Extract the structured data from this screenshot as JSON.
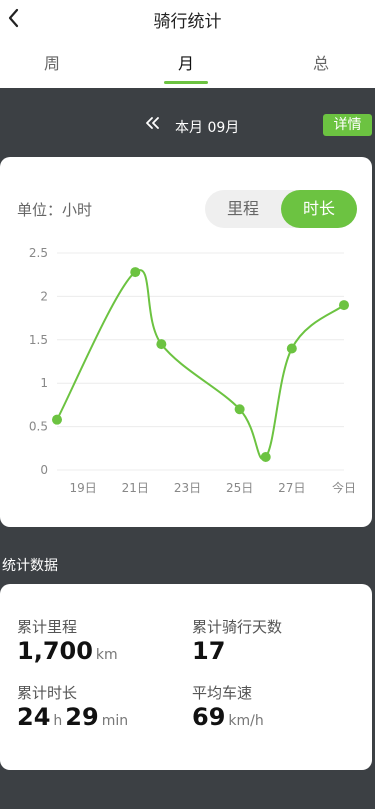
{
  "header": {
    "title": "骑行统计",
    "back_icon": "chevron-left-icon"
  },
  "tabs": [
    {
      "label": "周",
      "active": false
    },
    {
      "label": "月",
      "active": true
    },
    {
      "label": "总",
      "active": false
    }
  ],
  "month_bar": {
    "prev_icon": "double-chevron-left-icon",
    "label": "本月 09月",
    "detail_label": "详情"
  },
  "chart_section": {
    "unit_label": "单位：小时",
    "toggle": {
      "options": [
        "里程",
        "时长"
      ],
      "selected": "时长"
    }
  },
  "chart_data": {
    "type": "line",
    "categories": [
      "19日",
      "21日",
      "23日",
      "25日",
      "27日",
      "今日"
    ],
    "points": [
      {
        "x": 18,
        "y": 0.58
      },
      {
        "x": 21,
        "y": 2.28
      },
      {
        "x": 22,
        "y": 1.45
      },
      {
        "x": 25,
        "y": 0.7
      },
      {
        "x": 26,
        "y": 0.15
      },
      {
        "x": 27,
        "y": 1.4
      },
      {
        "x": 29,
        "y": 1.9
      }
    ],
    "yticks": [
      "0",
      "0.5",
      "1",
      "1.5",
      "2",
      "2.5"
    ],
    "ylim": [
      0,
      2.5
    ],
    "xlim": [
      18,
      29
    ],
    "grid": true,
    "color": "#6cc341"
  },
  "stats": {
    "section_title": "统计数据",
    "total_distance": {
      "label": "累计里程",
      "value": "1,700",
      "unit": "km"
    },
    "total_days": {
      "label": "累计骑行天数",
      "value": "17"
    },
    "total_duration": {
      "label": "累计时长",
      "hours": "24",
      "hours_unit": "h",
      "minutes": "29",
      "minutes_unit": "min"
    },
    "avg_speed": {
      "label": "平均车速",
      "value": "69",
      "unit": "km/h"
    }
  },
  "colors": {
    "accent": "#6cc341",
    "background": "#3c4044"
  }
}
